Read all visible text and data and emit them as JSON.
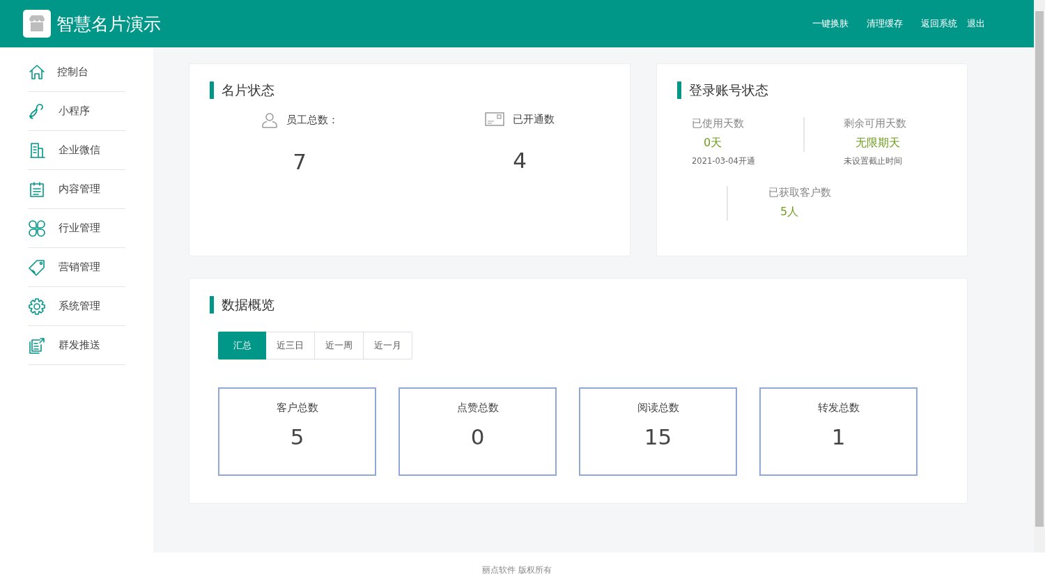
{
  "header": {
    "title": "智慧名片演示",
    "links": [
      "一键换肤",
      "清理缓存",
      "返回系统",
      "退出"
    ]
  },
  "sidebar": {
    "items": [
      {
        "label": "控制台",
        "selected": false
      },
      {
        "label": "小程序",
        "selected": false
      },
      {
        "label": "企业微信",
        "selected": false
      },
      {
        "label": "内容管理",
        "selected": false
      },
      {
        "label": "行业管理",
        "selected": false
      },
      {
        "label": "营销管理",
        "selected": false
      },
      {
        "label": "系统管理",
        "selected": false
      },
      {
        "label": "群发推送",
        "selected": false
      }
    ]
  },
  "card_status": {
    "title": "名片状态",
    "stats": [
      {
        "label": "员工总数：",
        "value": "7"
      },
      {
        "label": "已开通数",
        "value": "4"
      }
    ]
  },
  "account_status": {
    "title": "登录账号状态",
    "items": [
      {
        "label": "已使用天数",
        "value": "0天",
        "note": "2021-03-04开通"
      },
      {
        "label": "剩余可用天数",
        "value": "无限期天",
        "note": "未设置截止时间"
      },
      {
        "label": "已获取客户数",
        "value": "5人"
      }
    ]
  },
  "overview": {
    "title": "数据概览",
    "tabs": [
      {
        "label": "汇总",
        "selected": true
      },
      {
        "label": "近三日",
        "selected": false
      },
      {
        "label": "近一周",
        "selected": false
      },
      {
        "label": "近一月",
        "selected": false
      }
    ],
    "stats": [
      {
        "label": "客户总数",
        "value": "5"
      },
      {
        "label": "点赞总数",
        "value": "0"
      },
      {
        "label": "阅读总数",
        "value": "15"
      },
      {
        "label": "转发总数",
        "value": "1"
      }
    ]
  },
  "footer": {
    "text": "丽点软件 版权所有"
  }
}
